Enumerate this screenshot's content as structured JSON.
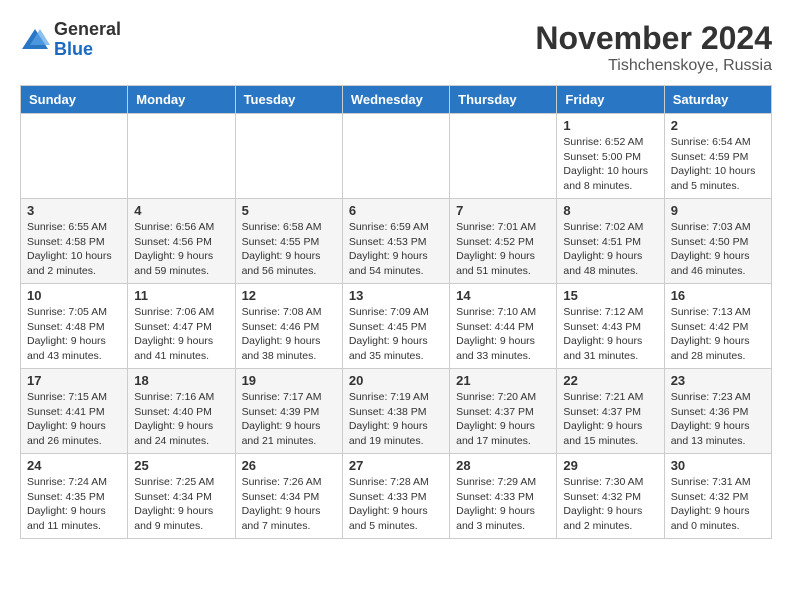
{
  "logo": {
    "general": "General",
    "blue": "Blue"
  },
  "title": "November 2024",
  "location": "Tishchenskoye, Russia",
  "days_of_week": [
    "Sunday",
    "Monday",
    "Tuesday",
    "Wednesday",
    "Thursday",
    "Friday",
    "Saturday"
  ],
  "weeks": [
    [
      {
        "day": "",
        "info": ""
      },
      {
        "day": "",
        "info": ""
      },
      {
        "day": "",
        "info": ""
      },
      {
        "day": "",
        "info": ""
      },
      {
        "day": "",
        "info": ""
      },
      {
        "day": "1",
        "info": "Sunrise: 6:52 AM\nSunset: 5:00 PM\nDaylight: 10 hours and 8 minutes."
      },
      {
        "day": "2",
        "info": "Sunrise: 6:54 AM\nSunset: 4:59 PM\nDaylight: 10 hours and 5 minutes."
      }
    ],
    [
      {
        "day": "3",
        "info": "Sunrise: 6:55 AM\nSunset: 4:58 PM\nDaylight: 10 hours and 2 minutes."
      },
      {
        "day": "4",
        "info": "Sunrise: 6:56 AM\nSunset: 4:56 PM\nDaylight: 9 hours and 59 minutes."
      },
      {
        "day": "5",
        "info": "Sunrise: 6:58 AM\nSunset: 4:55 PM\nDaylight: 9 hours and 56 minutes."
      },
      {
        "day": "6",
        "info": "Sunrise: 6:59 AM\nSunset: 4:53 PM\nDaylight: 9 hours and 54 minutes."
      },
      {
        "day": "7",
        "info": "Sunrise: 7:01 AM\nSunset: 4:52 PM\nDaylight: 9 hours and 51 minutes."
      },
      {
        "day": "8",
        "info": "Sunrise: 7:02 AM\nSunset: 4:51 PM\nDaylight: 9 hours and 48 minutes."
      },
      {
        "day": "9",
        "info": "Sunrise: 7:03 AM\nSunset: 4:50 PM\nDaylight: 9 hours and 46 minutes."
      }
    ],
    [
      {
        "day": "10",
        "info": "Sunrise: 7:05 AM\nSunset: 4:48 PM\nDaylight: 9 hours and 43 minutes."
      },
      {
        "day": "11",
        "info": "Sunrise: 7:06 AM\nSunset: 4:47 PM\nDaylight: 9 hours and 41 minutes."
      },
      {
        "day": "12",
        "info": "Sunrise: 7:08 AM\nSunset: 4:46 PM\nDaylight: 9 hours and 38 minutes."
      },
      {
        "day": "13",
        "info": "Sunrise: 7:09 AM\nSunset: 4:45 PM\nDaylight: 9 hours and 35 minutes."
      },
      {
        "day": "14",
        "info": "Sunrise: 7:10 AM\nSunset: 4:44 PM\nDaylight: 9 hours and 33 minutes."
      },
      {
        "day": "15",
        "info": "Sunrise: 7:12 AM\nSunset: 4:43 PM\nDaylight: 9 hours and 31 minutes."
      },
      {
        "day": "16",
        "info": "Sunrise: 7:13 AM\nSunset: 4:42 PM\nDaylight: 9 hours and 28 minutes."
      }
    ],
    [
      {
        "day": "17",
        "info": "Sunrise: 7:15 AM\nSunset: 4:41 PM\nDaylight: 9 hours and 26 minutes."
      },
      {
        "day": "18",
        "info": "Sunrise: 7:16 AM\nSunset: 4:40 PM\nDaylight: 9 hours and 24 minutes."
      },
      {
        "day": "19",
        "info": "Sunrise: 7:17 AM\nSunset: 4:39 PM\nDaylight: 9 hours and 21 minutes."
      },
      {
        "day": "20",
        "info": "Sunrise: 7:19 AM\nSunset: 4:38 PM\nDaylight: 9 hours and 19 minutes."
      },
      {
        "day": "21",
        "info": "Sunrise: 7:20 AM\nSunset: 4:37 PM\nDaylight: 9 hours and 17 minutes."
      },
      {
        "day": "22",
        "info": "Sunrise: 7:21 AM\nSunset: 4:37 PM\nDaylight: 9 hours and 15 minutes."
      },
      {
        "day": "23",
        "info": "Sunrise: 7:23 AM\nSunset: 4:36 PM\nDaylight: 9 hours and 13 minutes."
      }
    ],
    [
      {
        "day": "24",
        "info": "Sunrise: 7:24 AM\nSunset: 4:35 PM\nDaylight: 9 hours and 11 minutes."
      },
      {
        "day": "25",
        "info": "Sunrise: 7:25 AM\nSunset: 4:34 PM\nDaylight: 9 hours and 9 minutes."
      },
      {
        "day": "26",
        "info": "Sunrise: 7:26 AM\nSunset: 4:34 PM\nDaylight: 9 hours and 7 minutes."
      },
      {
        "day": "27",
        "info": "Sunrise: 7:28 AM\nSunset: 4:33 PM\nDaylight: 9 hours and 5 minutes."
      },
      {
        "day": "28",
        "info": "Sunrise: 7:29 AM\nSunset: 4:33 PM\nDaylight: 9 hours and 3 minutes."
      },
      {
        "day": "29",
        "info": "Sunrise: 7:30 AM\nSunset: 4:32 PM\nDaylight: 9 hours and 2 minutes."
      },
      {
        "day": "30",
        "info": "Sunrise: 7:31 AM\nSunset: 4:32 PM\nDaylight: 9 hours and 0 minutes."
      }
    ]
  ]
}
